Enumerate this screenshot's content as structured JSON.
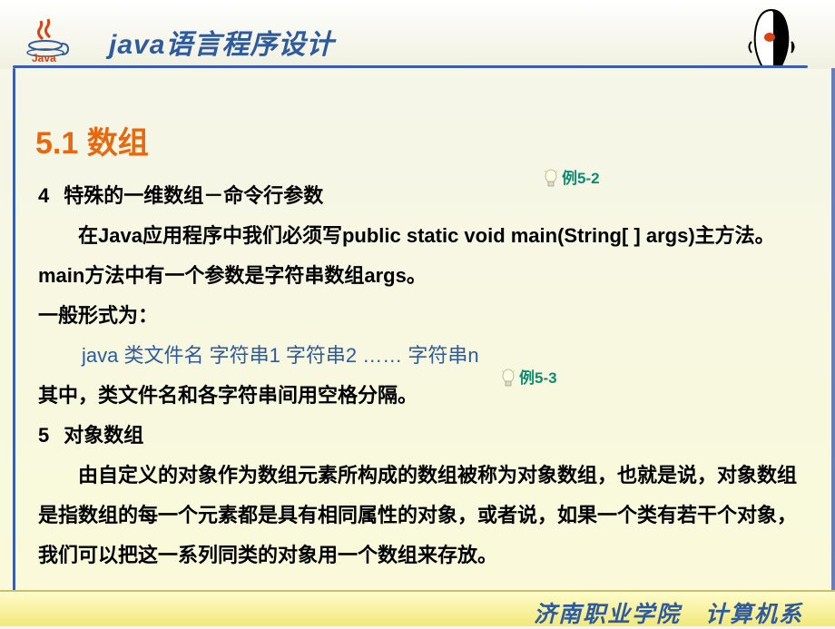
{
  "header": {
    "title": "java语言程序设计"
  },
  "section": {
    "title": "5.1  数组"
  },
  "sub4": {
    "num": "4",
    "title": "特殊的一维数组－命令行参数",
    "line2": "在Java应用程序中我们必须写public static void main(String[ ] args)主方法。",
    "line3": "main方法中有一个参数是字符串数组args。",
    "line4": "一般形式为：",
    "code": "java  类文件名  字符串1  字符串2 ……  字符串n",
    "line6": "其中，类文件名和各字符串间用空格分隔。"
  },
  "sub5": {
    "num": "5",
    "title": "对象数组",
    "line2": "由自定义的对象作为数组元素所构成的数组被称为对象数组，也就是说，对象数组是指数组的每一个元素都是具有相同属性的对象，或者说，如果一个类有若干个对象，我们可以把这一系列同类的对象用一个数组来存放。"
  },
  "examples": {
    "ex52": "例5-2",
    "ex53": "例5-3"
  },
  "footer": {
    "school": "济南职业学院",
    "dept": "计算机系"
  }
}
